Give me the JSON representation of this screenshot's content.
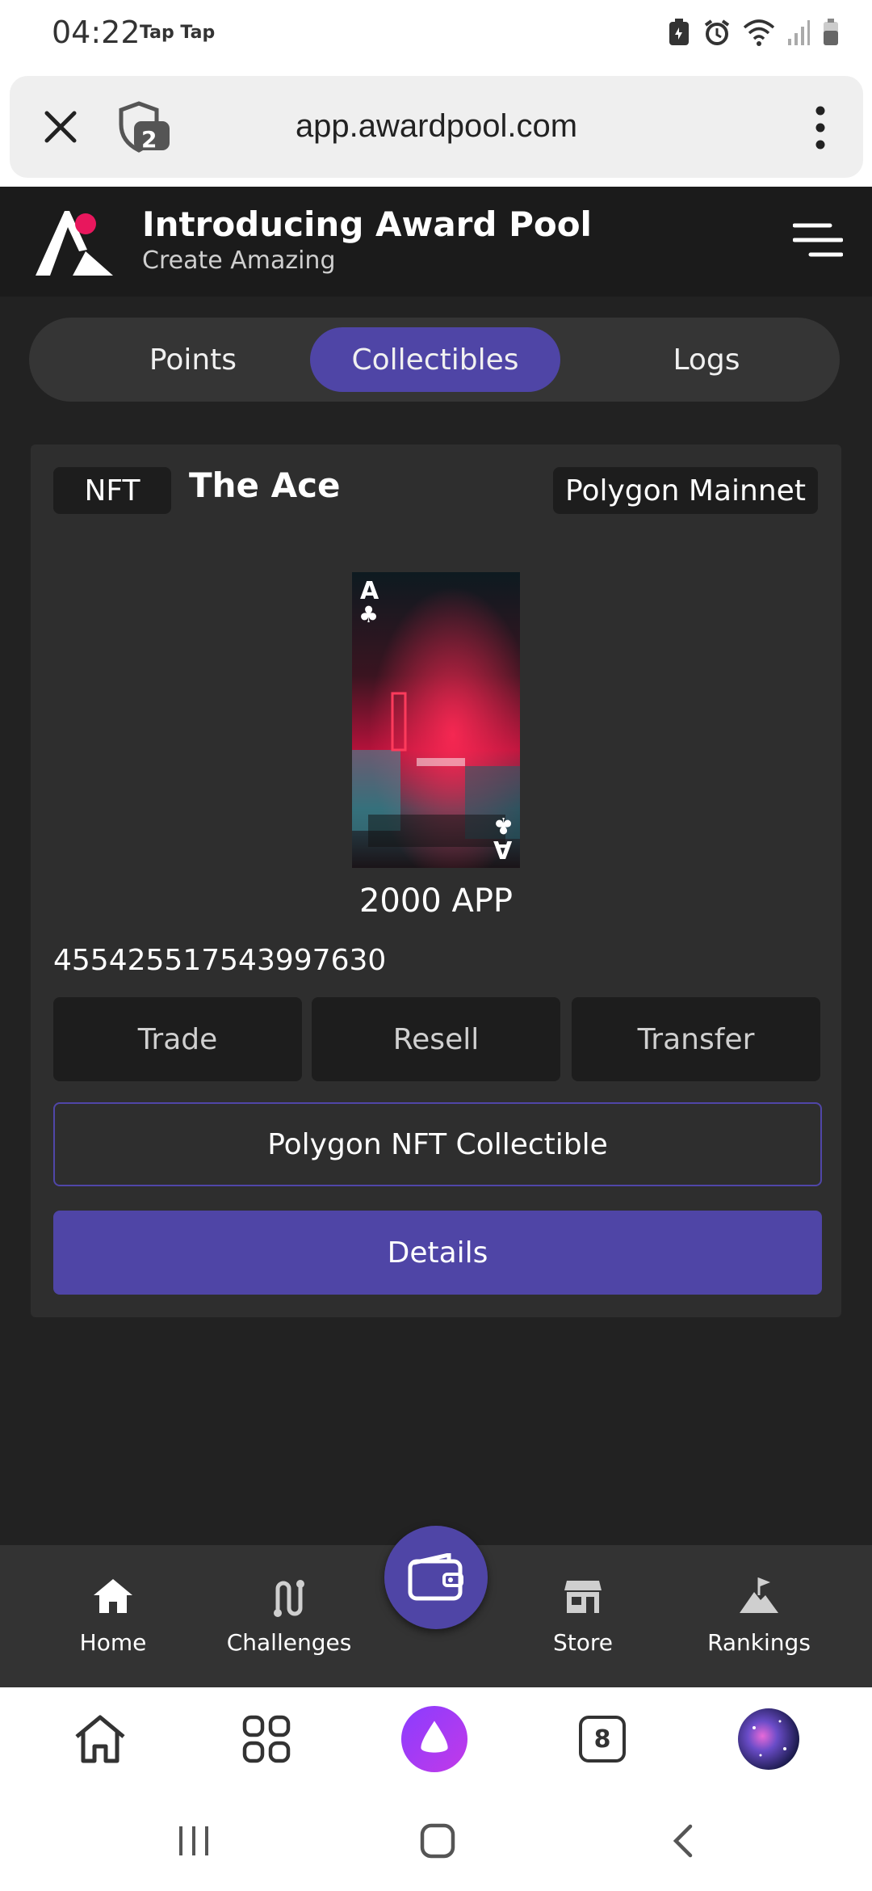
{
  "status_bar": {
    "time": "04:22",
    "apps": "Tap Tap"
  },
  "browser": {
    "url": "app.awardpool.com",
    "tab_count": "2"
  },
  "header": {
    "title": "Introducing Award Pool",
    "subtitle": "Create Amazing"
  },
  "tabs": [
    {
      "label": "Points",
      "active": false
    },
    {
      "label": "Collectibles",
      "active": true
    },
    {
      "label": "Logs",
      "active": false
    }
  ],
  "card": {
    "type_chip": "NFT",
    "title": "The Ace",
    "network_chip": "Polygon Mainnet",
    "card_rank": "A",
    "card_suit": "♣",
    "price": "2000 APP",
    "token_id": "455425517543997630",
    "actions": [
      "Trade",
      "Resell",
      "Transfer"
    ],
    "collectible_label": "Polygon NFT Collectible",
    "details_label": "Details"
  },
  "bottom_nav": [
    {
      "label": "Home",
      "icon": "home-icon"
    },
    {
      "label": "Challenges",
      "icon": "route-icon"
    },
    {
      "label": "Store",
      "icon": "store-icon"
    },
    {
      "label": "Rankings",
      "icon": "mountain-flag-icon"
    }
  ],
  "browser_toolbar": {
    "tab_count": "8"
  },
  "colors": {
    "accent": "#4f45a6",
    "background": "#222222",
    "card": "#2e2e2e",
    "logo_dot": "#e8175d"
  }
}
